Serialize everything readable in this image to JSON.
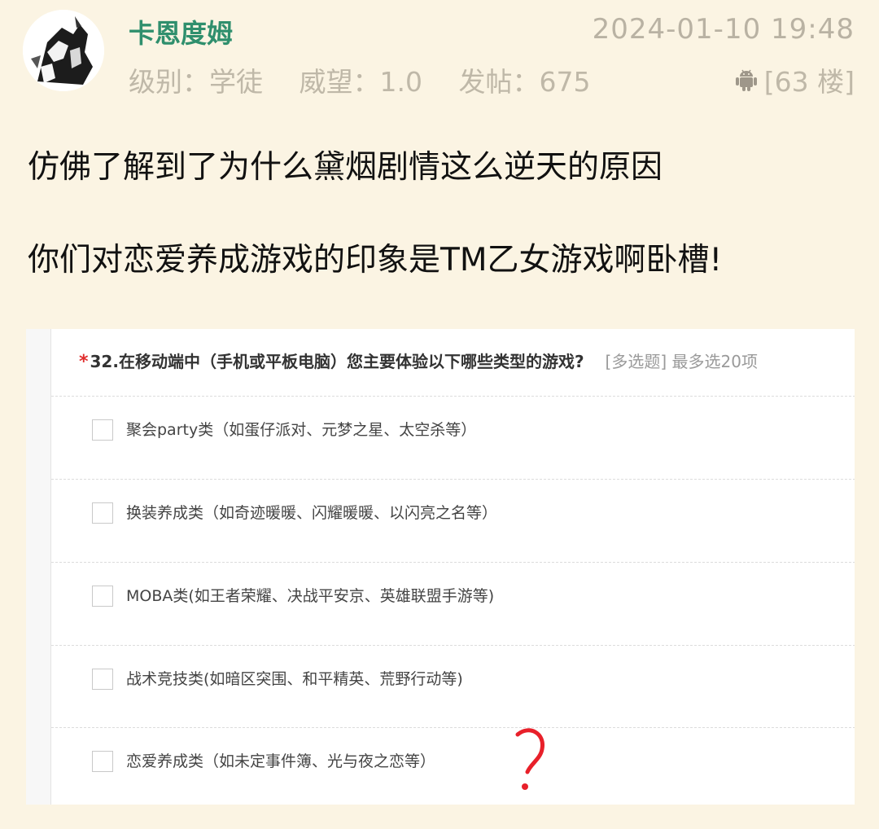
{
  "header": {
    "username": "卡恩度姆",
    "timestamp": "2024-01-10 19:48",
    "level": "级别：学徒",
    "prestige": "威望：1.0",
    "posts": "发帖：675",
    "floor": "[63 楼]",
    "platform_icon": "android-icon"
  },
  "body": {
    "line1": "仿佛了解到了为什么黛烟剧情这么逆天的原因",
    "line2": "你们对恋爱养成游戏的印象是TM乙女游戏啊卧槽!"
  },
  "survey": {
    "required_mark": "*",
    "question": "32.在移动端中（手机或平板电脑）您主要体验以下哪些类型的游戏?",
    "hint": "[多选题] 最多选20项",
    "options": [
      "聚会party类（如蛋仔派对、元梦之星、太空杀等）",
      "换装养成类（如奇迹暖暖、闪耀暖暖、以闪亮之名等）",
      "MOBA类(如王者荣耀、决战平安京、英雄联盟手游等)",
      "战术竞技类(如暗区突围、和平精英、荒野行动等)",
      "恋爱养成类（如未定事件簿、光与夜之恋等）"
    ]
  },
  "colors": {
    "background": "#fbf4e3",
    "username": "#2f8f6d",
    "meta": "#bfb8a8",
    "annotation": "#e8202a"
  }
}
